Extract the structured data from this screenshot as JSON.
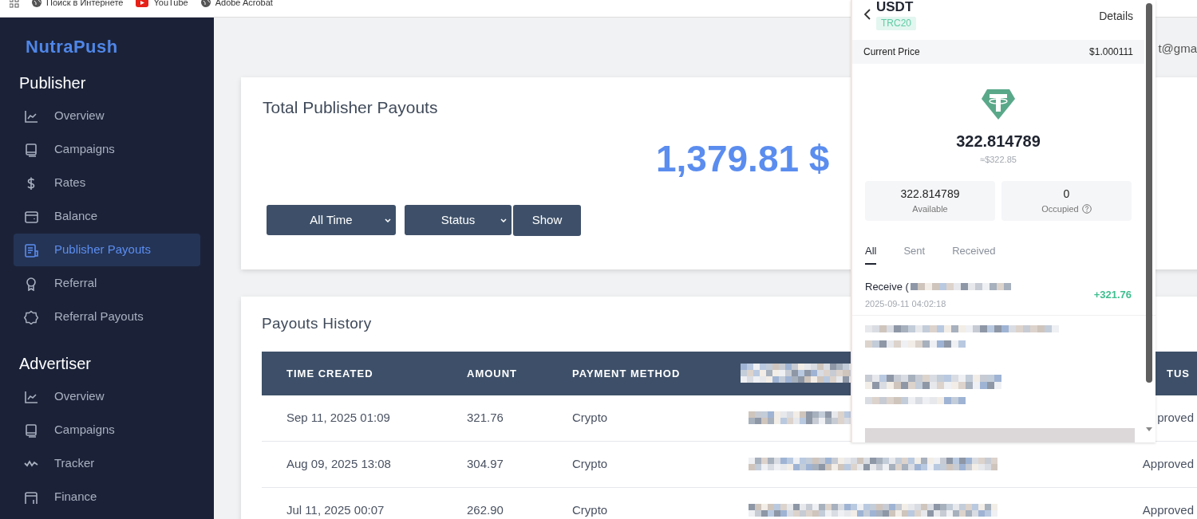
{
  "bookmarks": [
    {
      "label": "Поиск в Интернете",
      "kind": "globe"
    },
    {
      "label": "YouTube",
      "kind": "youtube"
    },
    {
      "label": "Adobe Acrobat",
      "kind": "globe"
    }
  ],
  "sidebar": {
    "logo": "NutraPush",
    "sections": [
      {
        "title": "Publisher",
        "items": [
          {
            "label": "Overview",
            "kind": "chart",
            "selected": false
          },
          {
            "label": "Campaigns",
            "kind": "book",
            "selected": false
          },
          {
            "label": "Rates",
            "kind": "dollar",
            "selected": false
          },
          {
            "label": "Balance",
            "kind": "wallet",
            "selected": false
          },
          {
            "label": "Publisher Payouts",
            "kind": "invoice",
            "selected": true
          },
          {
            "label": "Referral",
            "kind": "award",
            "selected": false
          },
          {
            "label": "Referral Payouts",
            "kind": "badge",
            "selected": false
          }
        ]
      },
      {
        "title": "Advertiser",
        "items": [
          {
            "label": "Overview",
            "kind": "chart",
            "selected": false
          },
          {
            "label": "Campaigns",
            "kind": "book",
            "selected": false
          },
          {
            "label": "Tracker",
            "kind": "wave",
            "selected": false
          },
          {
            "label": "Finance",
            "kind": "card",
            "selected": false
          }
        ]
      }
    ]
  },
  "header": {
    "user_email": "t@gma"
  },
  "payouts_card": {
    "title": "Total Publisher Payouts",
    "total": "1,379.81 $",
    "filters": [
      {
        "label": "All Time"
      },
      {
        "label": "Status"
      }
    ],
    "button": "Show"
  },
  "history": {
    "title": "Payouts History",
    "columns": [
      {
        "kind": "text",
        "label": "TIME CREATED"
      },
      {
        "kind": "text",
        "label": "AMOUNT"
      },
      {
        "kind": "text",
        "label": "PAYMENT METHOD"
      },
      {
        "kind": "redacted"
      },
      {
        "kind": "status",
        "label": "TUS"
      }
    ],
    "rows": [
      {
        "time_created": "Sep 11, 2025 01:09",
        "amount": "321.76",
        "payment_method": "Crypto",
        "status": "proved"
      },
      {
        "time_created": "Aug 09, 2025 13:08",
        "amount": "304.97",
        "payment_method": "Crypto",
        "status": "Approved"
      },
      {
        "time_created": "Jul 11, 2025 00:07",
        "amount": "262.90",
        "payment_method": "Crypto",
        "status": "Approved"
      }
    ]
  },
  "wallet": {
    "coin": "USDT",
    "network": "TRC20",
    "details_link": "Details",
    "price_label": "Current Price",
    "price": "$1.000111",
    "balance": "322.814789",
    "balance_usd": "≈$322.85",
    "stats": [
      {
        "value": "322.814789",
        "label": "Available",
        "help": false
      },
      {
        "value": "0",
        "label": "Occupied",
        "help": true
      }
    ],
    "tabs": [
      {
        "label": "All",
        "selected": true
      },
      {
        "label": "Sent",
        "selected": false
      },
      {
        "label": "Received",
        "selected": false
      }
    ],
    "transactions": [
      {
        "title": "Receive (",
        "date": "2025-09-11 04:02:18",
        "amount": "+321.76"
      }
    ]
  }
}
